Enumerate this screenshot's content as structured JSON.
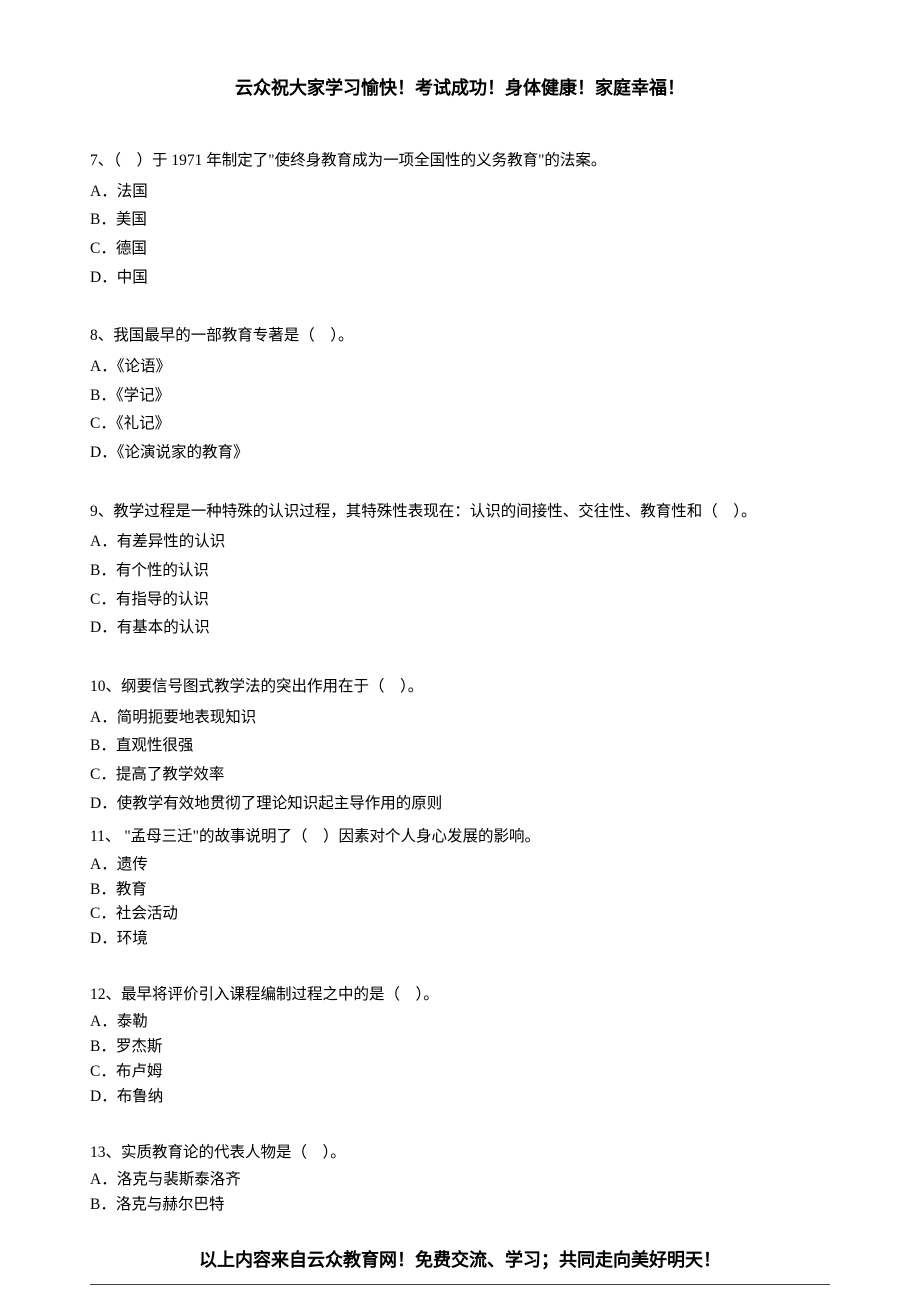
{
  "header": "云众祝大家学习愉快！考试成功！身体健康！家庭幸福！",
  "footer": "以上内容来自云众教育网！免费交流、学习；共同走向美好明天！",
  "questions": [
    {
      "num": "7、",
      "stem": "（　）于 1971 年制定了\"使终身教育成为一项全国性的义务教育\"的法案。",
      "options": [
        "A．法国",
        "B．美国",
        "C．德国",
        "D．中国"
      ]
    },
    {
      "num": "8、",
      "stem": "我国最早的一部教育专著是（　）。",
      "options": [
        "A．《论语》",
        "B．《学记》",
        "C．《礼记》",
        "D．《论演说家的教育》"
      ]
    },
    {
      "num": "9、",
      "stem": "教学过程是一种特殊的认识过程，其特殊性表现在：认识的间接性、交往性、教育性和（　）。",
      "options": [
        "A．有差异性的认识",
        "B．有个性的认识",
        "C．有指导的认识",
        "D．有基本的认识"
      ]
    },
    {
      "num": "10、",
      "stem": "纲要信号图式教学法的突出作用在于（　）。",
      "options": [
        "A．简明扼要地表现知识",
        "B．直观性很强",
        "C．提高了教学效率",
        "D．使教学有效地贯彻了理论知识起主导作用的原则"
      ]
    },
    {
      "num": "11、",
      "stem": " \"孟母三迁\"的故事说明了（　）因素对个人身心发展的影响。",
      "options": [
        "A．遗传",
        "B．教育",
        "C．社会活动",
        "D．环境"
      ]
    },
    {
      "num": "12、",
      "stem": "最早将评价引入课程编制过程之中的是（　）。",
      "options": [
        "A．泰勒",
        "B．罗杰斯",
        "C．布卢姆",
        "D．布鲁纳"
      ]
    },
    {
      "num": "13、",
      "stem": "实质教育论的代表人物是（　）。",
      "options": [
        "A．洛克与裴斯泰洛齐",
        "B．洛克与赫尔巴特"
      ]
    }
  ]
}
